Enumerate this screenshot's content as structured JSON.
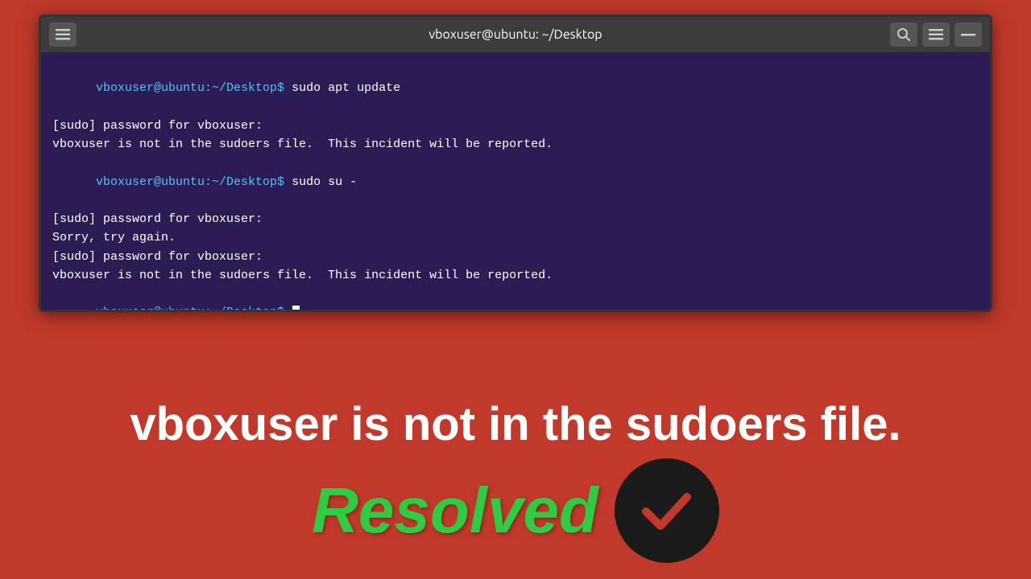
{
  "terminal": {
    "title": "vboxuser@ubuntu: ~/Desktop",
    "lines": [
      {
        "type": "prompt_cmd",
        "prompt": "vboxuser@ubuntu:~/Desktop$ ",
        "cmd": "sudo apt update"
      },
      {
        "type": "output",
        "text": "[sudo] password for vboxuser: "
      },
      {
        "type": "output",
        "text": "vboxuser is not in the sudoers file.  This incident will be reported."
      },
      {
        "type": "prompt_cmd",
        "prompt": "vboxuser@ubuntu:~/Desktop$ ",
        "cmd": "sudo su -"
      },
      {
        "type": "output",
        "text": "[sudo] password for vboxuser:"
      },
      {
        "type": "output",
        "text": "Sorry, try again."
      },
      {
        "type": "output",
        "text": "[sudo] password for vboxuser:"
      },
      {
        "type": "output",
        "text": "vboxuser is not in the sudoers file.  This incident will be reported."
      },
      {
        "type": "prompt_only",
        "prompt": "vboxuser@ubuntu:~/Desktop$ "
      }
    ]
  },
  "subtitle": {
    "main_text": "vboxuser is not in the sudoers file."
  },
  "resolved": {
    "label": "Resolved"
  }
}
